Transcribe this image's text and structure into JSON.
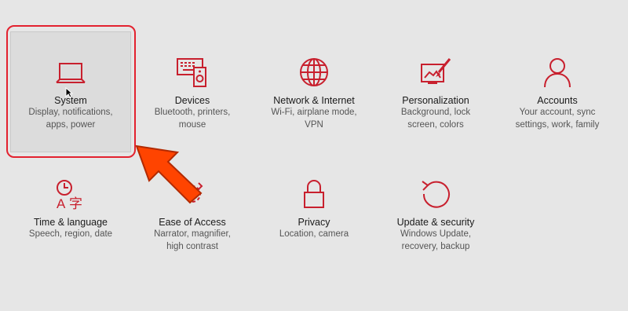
{
  "accent_color": "#c8202e",
  "annotation_color": "#ff4400",
  "tiles": [
    {
      "title": "System",
      "desc1": "Display, notifications,",
      "desc2": "apps, power",
      "icon": "laptop-icon"
    },
    {
      "title": "Devices",
      "desc1": "Bluetooth, printers,",
      "desc2": "mouse",
      "icon": "devices-icon"
    },
    {
      "title": "Network & Internet",
      "desc1": "Wi-Fi, airplane mode,",
      "desc2": "VPN",
      "icon": "globe-icon"
    },
    {
      "title": "Personalization",
      "desc1": "Background, lock",
      "desc2": "screen, colors",
      "icon": "paintbrush-icon"
    },
    {
      "title": "Accounts",
      "desc1": "Your account, sync",
      "desc2": "settings, work, family",
      "icon": "person-icon"
    },
    {
      "title": "Time & language",
      "desc1": "Speech, region, date",
      "desc2": "",
      "icon": "time-language-icon"
    },
    {
      "title": "Ease of Access",
      "desc1": "Narrator, magnifier,",
      "desc2": "high contrast",
      "icon": "ease-of-access-icon"
    },
    {
      "title": "Privacy",
      "desc1": "Location, camera",
      "desc2": "",
      "icon": "lock-icon"
    },
    {
      "title": "Update & security",
      "desc1": "Windows Update,",
      "desc2": "recovery, backup",
      "icon": "refresh-icon"
    }
  ]
}
